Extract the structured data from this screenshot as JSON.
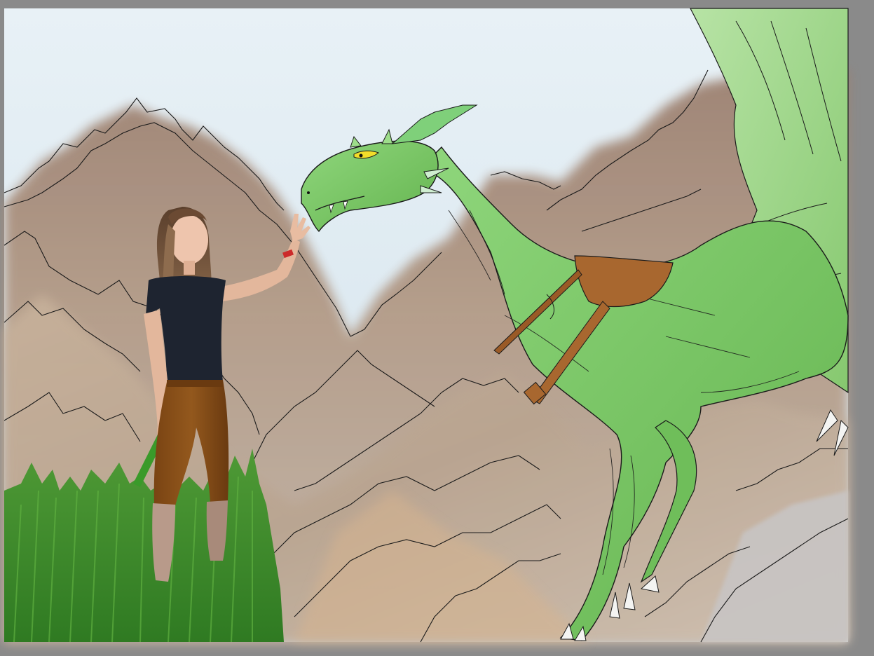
{
  "canvas": {
    "background": "#8a8a8a",
    "sky_color": "#dde8ef",
    "mountain_color": "#b39a86",
    "grass_color": "#3f8a2c",
    "dragon_color": "#79c766",
    "saddle_color": "#a86a34"
  }
}
